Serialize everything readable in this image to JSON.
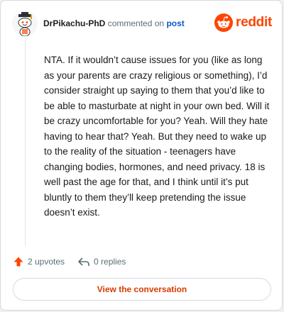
{
  "comment_header": {
    "username": "DrPikachu-PhD",
    "action_text": "commented on",
    "post_link_label": "post"
  },
  "brand": {
    "wordmark": "reddit",
    "logo_icon": "reddit-snoo-icon",
    "color": "#ff4500"
  },
  "comment": {
    "body": "NTA. If it wouldn’t cause issues for you (like as long as your parents are crazy religious or something), I’d consider straight up saying to them that you’d like to be able to masturbate at night in your own bed. Will it be crazy uncomfortable for you? Yeah. Will they hate having to hear that? Yeah. But they need to wake up to the reality of the situation - teenagers have changing bodies, hormones, and need privacy. 18 is well past the age for that, and I think until it’s put bluntly to them they’ll keep pretending the issue doesn’t exist."
  },
  "footer": {
    "upvotes_label": "2 upvotes",
    "upvote_icon": "upvote-arrow-icon",
    "upvote_color": "#ff4500",
    "replies_label": "0 replies",
    "reply_icon": "reply-arrow-icon"
  },
  "view_button": {
    "label": "View the conversation",
    "color": "#d93a00"
  }
}
